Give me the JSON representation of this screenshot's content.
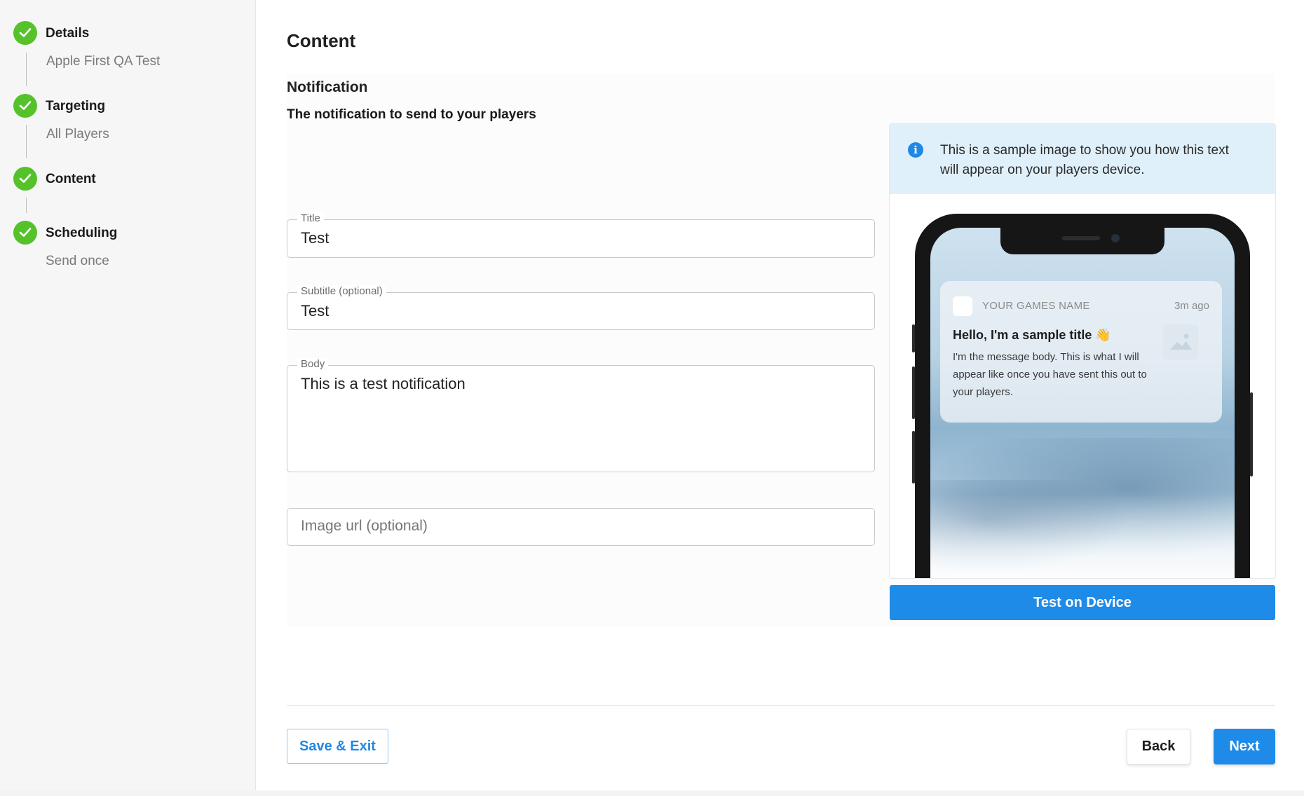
{
  "sidebar": {
    "steps": [
      {
        "title": "Details",
        "subtitle": "Apple First QA Test",
        "status": "complete"
      },
      {
        "title": "Targeting",
        "subtitle": "All Players",
        "status": "complete"
      },
      {
        "title": "Content",
        "subtitle": "",
        "status": "complete"
      },
      {
        "title": "Scheduling",
        "subtitle": "Send once",
        "status": "complete"
      }
    ]
  },
  "main": {
    "title": "Content",
    "section_title": "Notification",
    "section_subtitle": "The notification to send to your players",
    "fields": {
      "title": {
        "label": "Title",
        "value": "Test"
      },
      "subtitle": {
        "label": "Subtitle (optional)",
        "value": "Test"
      },
      "body": {
        "label": "Body",
        "value": "This is a test notification"
      },
      "image_url": {
        "placeholder": "Image url (optional)",
        "value": ""
      }
    },
    "preview": {
      "info_text": "This is a sample image to show you how this text will appear on your players device.",
      "notification": {
        "app_name": "YOUR GAMES NAME",
        "time": "3m ago",
        "title": "Hello, I'm a sample title",
        "emoji": "👋",
        "body": "I'm the message body. This is what I will appear like once you have sent this out to your players."
      },
      "test_button": "Test on Device"
    }
  },
  "footer": {
    "save_exit": "Save & Exit",
    "back": "Back",
    "next": "Next"
  },
  "colors": {
    "accent": "#1f8be8",
    "success": "#55c22b",
    "info_bg": "#e0f0fb"
  }
}
